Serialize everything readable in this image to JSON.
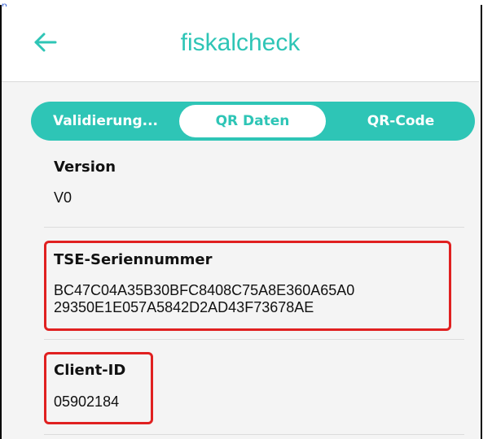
{
  "app": {
    "title": "fiskalcheck",
    "accent_color": "#2ec5b6"
  },
  "top_strip": {
    "text": "p"
  },
  "tabs": [
    {
      "label": "Validierung...",
      "active": false
    },
    {
      "label": "QR Daten",
      "active": true
    },
    {
      "label": "QR-Code",
      "active": false
    }
  ],
  "fields": {
    "version": {
      "label": "Version",
      "value": "V0"
    },
    "tse": {
      "label": "TSE-Seriennummer",
      "value_line1": "BC47C04A35B30BFC8408C75A8E360A65A0",
      "value_line2": "29350E1E057A5842D2AD43F73678AE"
    },
    "client": {
      "label": "Client-ID",
      "value": "05902184"
    }
  },
  "highlight_color": "#e02020"
}
